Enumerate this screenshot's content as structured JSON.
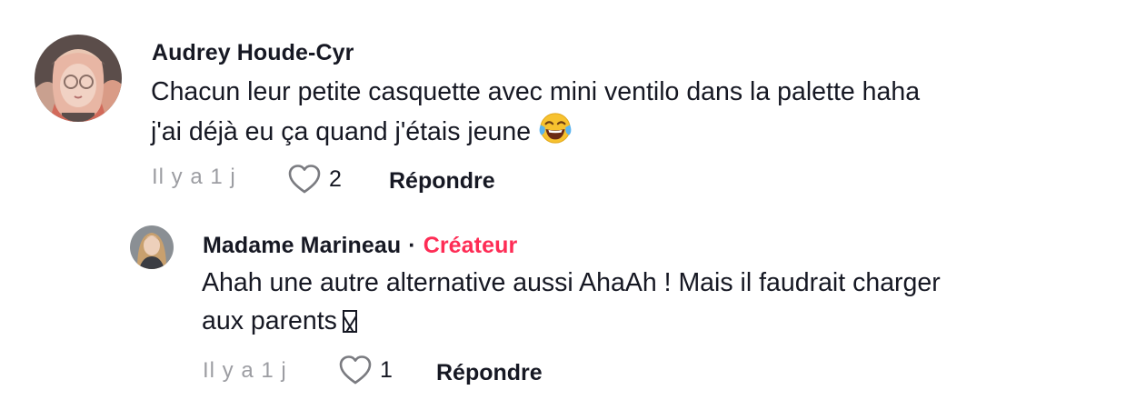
{
  "comments": {
    "top": {
      "author": "Audrey Houde-Cyr",
      "text_line1": "Chacun leur petite casquette avec mini ventilo dans la palette haha",
      "text_line2": "j'ai déjà eu ça quand j'étais jeune",
      "emoji": "face-with-tears-of-joy-icon",
      "time": "Il y a 1 j",
      "like_count": "2",
      "reply_label": "Répondre"
    },
    "reply": {
      "author": "Madame Marineau",
      "separator": "·",
      "badge": "Créateur",
      "text_line1": "Ahah une autre alternative aussi AhaAh ! Mais il faudrait charger",
      "text_line2": "aux parents",
      "time": "Il y a 1 j",
      "like_count": "1",
      "reply_label": "Répondre"
    }
  },
  "colors": {
    "text": "#161823",
    "muted": "#9c9da2",
    "creator_badge": "#fe2c55"
  }
}
